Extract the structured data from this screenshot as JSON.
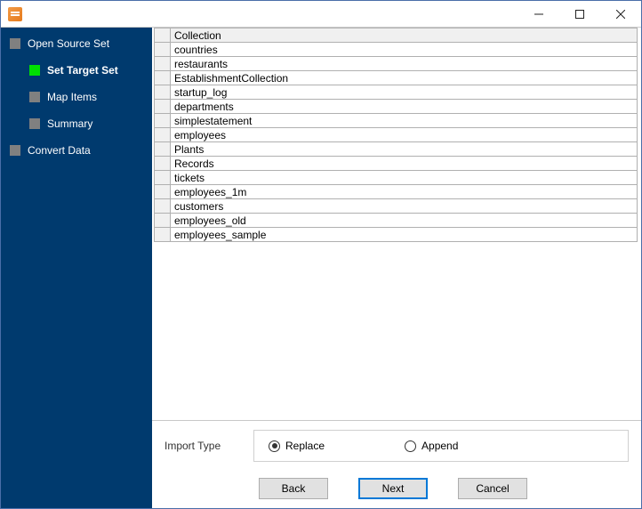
{
  "window": {
    "title": ""
  },
  "sidebar": {
    "items": [
      {
        "label": "Open Source Set",
        "level": 0,
        "active": false
      },
      {
        "label": "Set Target Set",
        "level": 1,
        "active": true
      },
      {
        "label": "Map Items",
        "level": 1,
        "active": false
      },
      {
        "label": "Summary",
        "level": 1,
        "active": false
      },
      {
        "label": "Convert Data",
        "level": 0,
        "active": false
      }
    ]
  },
  "table": {
    "header": "Collection",
    "rows": [
      "countries",
      "restaurants",
      "EstablishmentCollection",
      "startup_log",
      "departments",
      "simplestatement",
      "employees",
      "Plants",
      "Records",
      "tickets",
      "employees_1m",
      "customers",
      "employees_old",
      "employees_sample"
    ]
  },
  "import": {
    "label": "Import Type",
    "options": [
      {
        "label": "Replace",
        "selected": true
      },
      {
        "label": "Append",
        "selected": false
      }
    ]
  },
  "buttons": {
    "back": "Back",
    "next": "Next",
    "cancel": "Cancel"
  }
}
